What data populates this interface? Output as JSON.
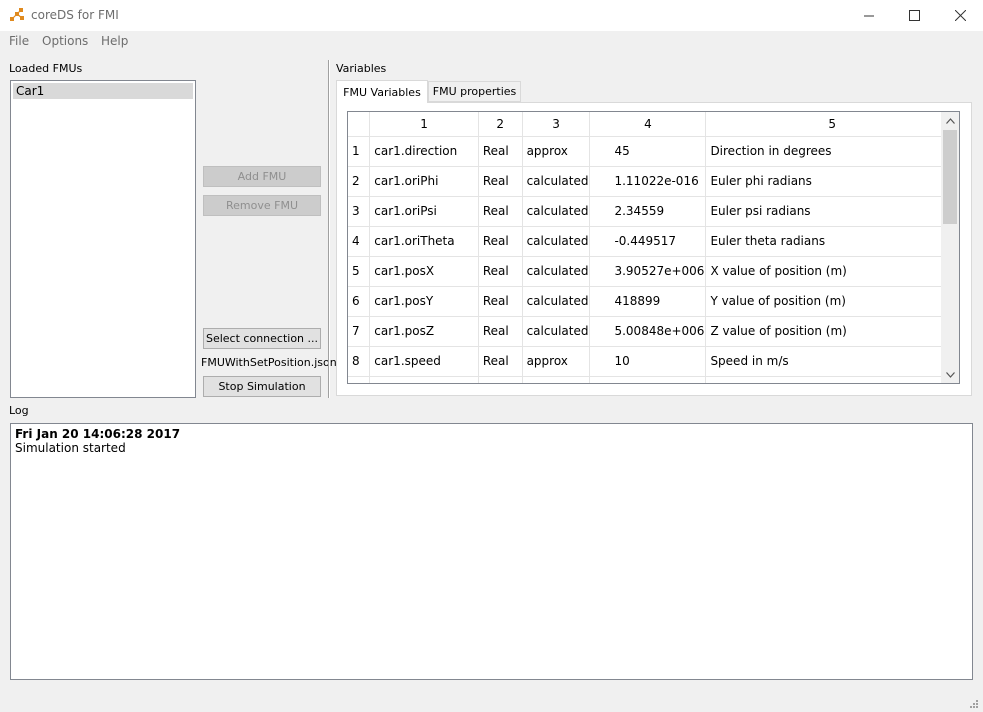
{
  "window": {
    "title": "coreDS for FMI",
    "icon": "network-nodes-icon",
    "accent_color": "#e08a1e"
  },
  "menu": {
    "items": [
      "File",
      "Options",
      "Help"
    ]
  },
  "loaded_fmus": {
    "label": "Loaded FMUs",
    "items": [
      "Car1"
    ]
  },
  "buttons": {
    "add_fmu": "Add FMU",
    "remove_fmu": "Remove FMU",
    "select_connection": "Select connection ...",
    "connection_file": "FMUWithSetPosition.json",
    "stop_simulation": "Stop Simulation"
  },
  "variables": {
    "label": "Variables",
    "tabs": [
      "FMU Variables",
      "FMU properties"
    ],
    "active_tab": 0,
    "columns": [
      "1",
      "2",
      "3",
      "4",
      "5"
    ],
    "rows": [
      {
        "n": "1",
        "name": "car1.direction",
        "type": "Real",
        "causality": "approx",
        "value": "45",
        "desc": "Direction in degrees"
      },
      {
        "n": "2",
        "name": "car1.oriPhi",
        "type": "Real",
        "causality": "calculated",
        "value": "1.11022e-016",
        "desc": "Euler phi radians"
      },
      {
        "n": "3",
        "name": "car1.oriPsi",
        "type": "Real",
        "causality": "calculated",
        "value": "2.34559",
        "desc": "Euler psi radians"
      },
      {
        "n": "4",
        "name": "car1.oriTheta",
        "type": "Real",
        "causality": "calculated",
        "value": "-0.449517",
        "desc": "Euler theta radians"
      },
      {
        "n": "5",
        "name": "car1.posX",
        "type": "Real",
        "causality": "calculated",
        "value": "3.90527e+006",
        "desc": "X value of position (m)"
      },
      {
        "n": "6",
        "name": "car1.posY",
        "type": "Real",
        "causality": "calculated",
        "value": "418899",
        "desc": "Y value of position (m)"
      },
      {
        "n": "7",
        "name": "car1.posZ",
        "type": "Real",
        "causality": "calculated",
        "value": "5.00848e+006",
        "desc": "Z value of position (m)"
      },
      {
        "n": "8",
        "name": "car1.speed",
        "type": "Real",
        "causality": "approx",
        "value": "10",
        "desc": "Speed in m/s"
      }
    ]
  },
  "log": {
    "label": "Log",
    "timestamp": "Fri Jan 20 14:06:28 2017",
    "message": "Simulation started"
  }
}
